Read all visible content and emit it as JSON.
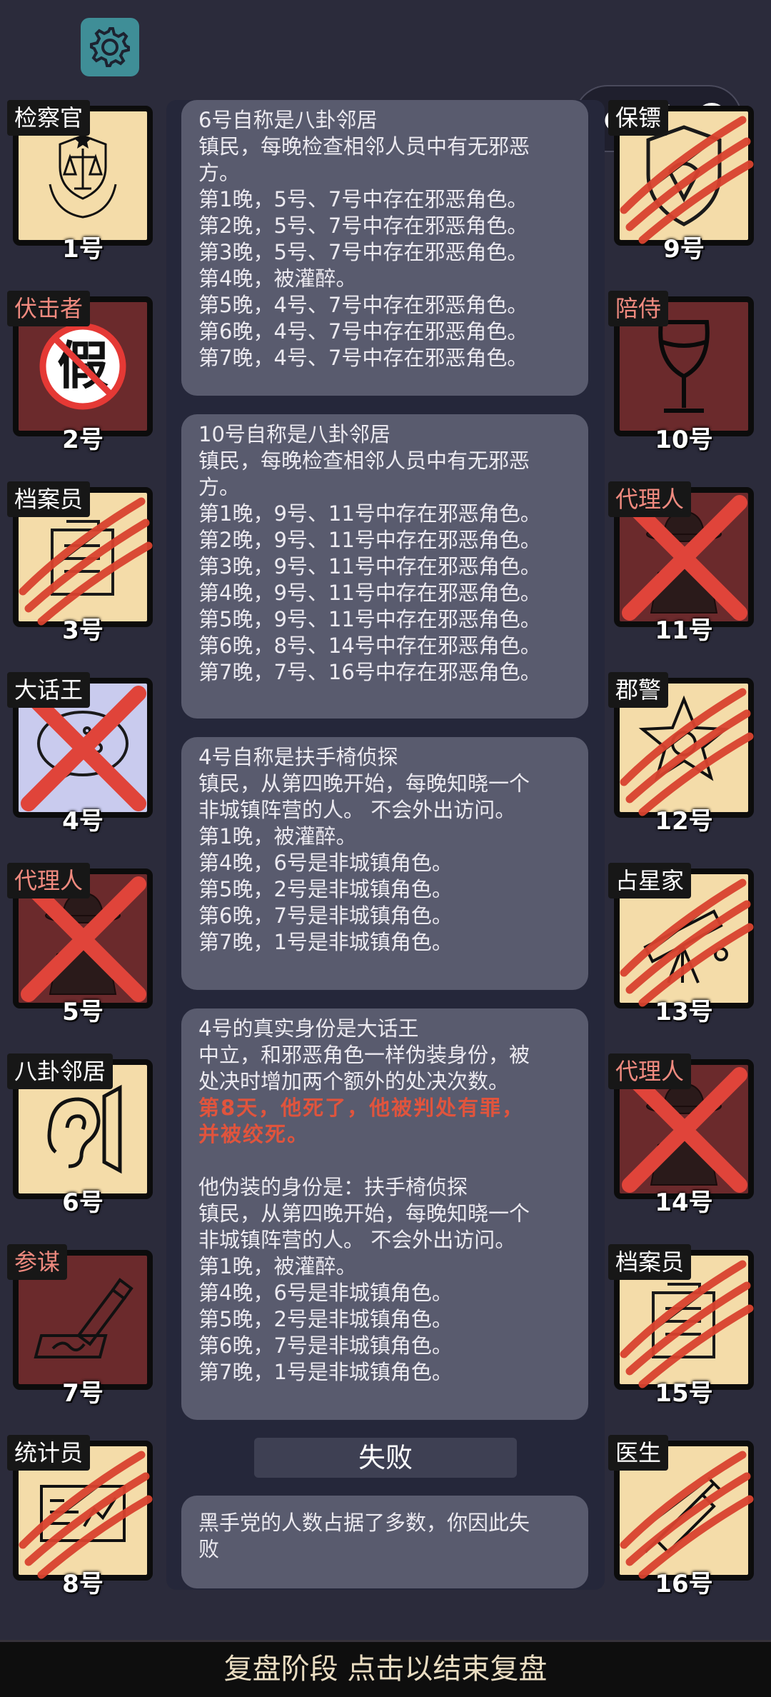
{
  "icons": {
    "settings": "gear-icon",
    "menu": "more-dots-icon",
    "close": "target-icon"
  },
  "colors": {
    "background": "#2b2b3b",
    "card": "#595b6e",
    "highlight": "#e0543d",
    "slash": "#d9432f"
  },
  "cards": [
    {
      "lines": [
        "6号自称是八卦邻居",
        "镇民，每晚检查相邻人员中有无邪恶",
        "方。",
        "第1晚，5号、7号中存在邪恶角色。",
        "第2晚，5号、7号中存在邪恶角色。",
        "第3晚，5号、7号中存在邪恶角色。",
        "第4晚，被灌醉。",
        "第5晚，4号、7号中存在邪恶角色。",
        "第6晚，4号、7号中存在邪恶角色。",
        "第7晚，4号、7号中存在邪恶角色。"
      ]
    },
    {
      "lines": [
        "10号自称是八卦邻居",
        "镇民，每晚检查相邻人员中有无邪恶",
        "方。",
        "第1晚，9号、11号中存在邪恶角色。",
        "第2晚，9号、11号中存在邪恶角色。",
        "第3晚，9号、11号中存在邪恶角色。",
        "第4晚，9号、11号中存在邪恶角色。",
        "第5晚，9号、11号中存在邪恶角色。",
        "第6晚，8号、14号中存在邪恶角色。",
        "第7晚，7号、16号中存在邪恶角色。"
      ]
    },
    {
      "lines": [
        "4号自称是扶手椅侦探",
        "镇民，从第四晚开始，每晚知晓一个",
        "非城镇阵营的人。 不会外出访问。",
        "第1晚，被灌醉。",
        "第4晚，6号是非城镇角色。",
        "第5晚，2号是非城镇角色。",
        "第6晚，7号是非城镇角色。",
        "第7晚，1号是非城镇角色。"
      ]
    },
    {
      "lines_a": [
        "4号的真实身份是大话王",
        "中立，和邪恶角色一样伪装身份，被",
        "处决时增加两个额外的处决次数。"
      ],
      "red": [
        "第8天，他死了，他被判处有罪，",
        "并被绞死。"
      ],
      "lines_b": [
        "他伪装的身份是：扶手椅侦探",
        "镇民，从第四晚开始，每晚知晓一个",
        "非城镇阵营的人。 不会外出访问。",
        "第1晚，被灌醉。",
        "第4晚，6号是非城镇角色。",
        "第5晚，2号是非城镇角色。",
        "第6晚，7号是非城镇角色。",
        "第7晚，1号是非城镇角色。"
      ]
    }
  ],
  "result_title": "失败",
  "result_card": {
    "lines": [
      "黑手党的人数占据了多数，你因此失",
      "败"
    ]
  },
  "players_left": [
    {
      "role": "检察官",
      "number": "1号",
      "role_color": "white",
      "tile": "light",
      "icon": "justice-emblem-icon",
      "mark": "none"
    },
    {
      "role": "伏击者",
      "number": "2号",
      "role_color": "red",
      "tile": "dark",
      "icon": "fake-prohibited-icon",
      "mark": "none"
    },
    {
      "role": "档案员",
      "number": "3号",
      "role_color": "white",
      "tile": "light",
      "icon": "archive-folder-icon",
      "mark": "slash"
    },
    {
      "role": "大话王",
      "number": "4号",
      "role_color": "white",
      "tile": "blue",
      "icon": "speech-bubble-icon",
      "mark": "cross"
    },
    {
      "role": "代理人",
      "number": "5号",
      "role_color": "red",
      "tile": "dark",
      "icon": "agent-hat-icon",
      "mark": "cross"
    },
    {
      "role": "八卦邻居",
      "number": "6号",
      "role_color": "white",
      "tile": "light",
      "icon": "ear-wall-icon",
      "mark": "none"
    },
    {
      "role": "参谋",
      "number": "7号",
      "role_color": "red",
      "tile": "dark",
      "icon": "pen-writing-icon",
      "mark": "none"
    },
    {
      "role": "统计员",
      "number": "8号",
      "role_color": "white",
      "tile": "light",
      "icon": "chart-paper-icon",
      "mark": "slash"
    }
  ],
  "players_right": [
    {
      "role": "保镖",
      "number": "9号",
      "role_color": "white",
      "tile": "light",
      "icon": "shield-icon",
      "mark": "slash"
    },
    {
      "role": "陪侍",
      "number": "10号",
      "role_color": "red",
      "tile": "dark",
      "icon": "wine-glass-icon",
      "mark": "none"
    },
    {
      "role": "代理人",
      "number": "11号",
      "role_color": "red",
      "tile": "dark",
      "icon": "agent-hat-icon",
      "mark": "cross"
    },
    {
      "role": "郡警",
      "number": "12号",
      "role_color": "white",
      "tile": "light",
      "icon": "sheriff-star-icon",
      "mark": "slash"
    },
    {
      "role": "占星家",
      "number": "13号",
      "role_color": "white",
      "tile": "light",
      "icon": "telescope-icon",
      "mark": "slash"
    },
    {
      "role": "代理人",
      "number": "14号",
      "role_color": "red",
      "tile": "dark",
      "icon": "agent-hat-icon",
      "mark": "cross"
    },
    {
      "role": "档案员",
      "number": "15号",
      "role_color": "white",
      "tile": "light",
      "icon": "archive-folder-icon",
      "mark": "slash"
    },
    {
      "role": "医生",
      "number": "16号",
      "role_color": "white",
      "tile": "light",
      "icon": "syringe-icon",
      "mark": "slash"
    }
  ],
  "footer": "复盘阶段 点击以结束复盘"
}
